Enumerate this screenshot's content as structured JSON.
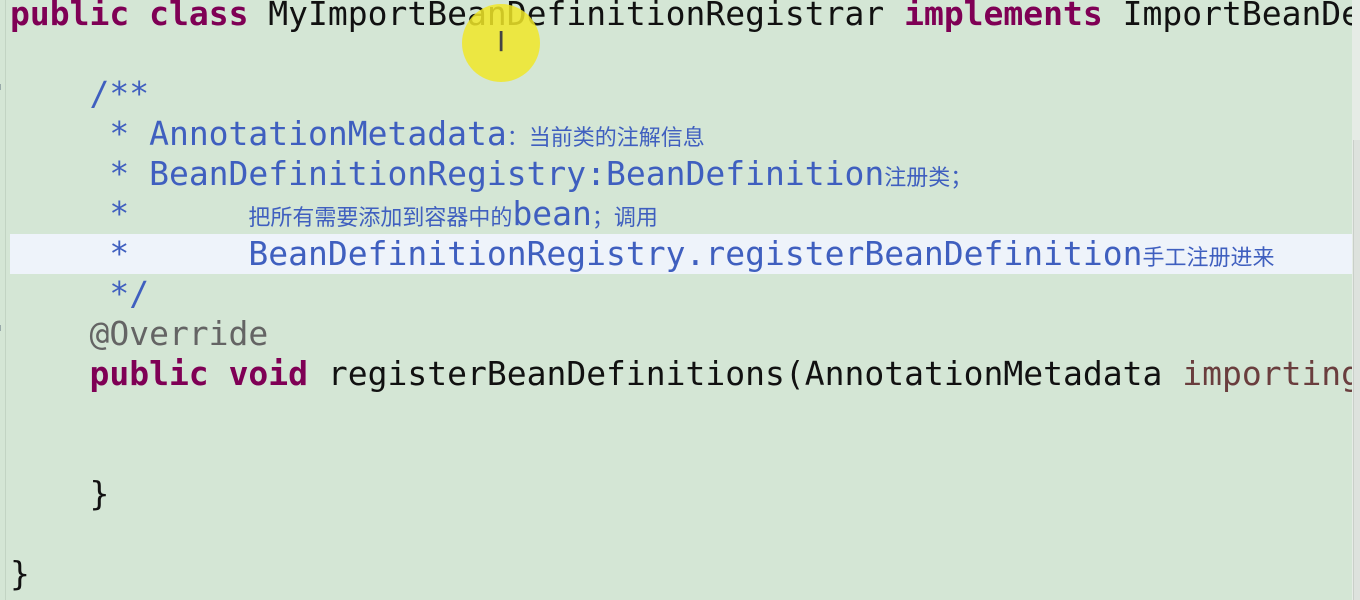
{
  "colors": {
    "background": "#d4e6d5",
    "keyword": "#7f0055",
    "javadoc": "#3f5fbf",
    "annotation": "#646464",
    "parameter": "#6a3e3e",
    "current_line": "#eef3fa",
    "cursor_highlight": "#f0e628"
  },
  "cursor": {
    "icon": "text-ibeam-icon",
    "glyph": "I"
  },
  "editor": {
    "current_line_index": 6,
    "lines": [
      {
        "tokens": [
          {
            "t": "kw",
            "v": "public"
          },
          {
            "t": "pl",
            "v": " "
          },
          {
            "t": "kw",
            "v": "class"
          },
          {
            "t": "pl",
            "v": " MyImportBeanDefinitionRegistrar "
          },
          {
            "t": "kw",
            "v": "implements"
          },
          {
            "t": "pl",
            "v": " ImportBeanDe"
          }
        ]
      },
      {
        "tokens": []
      },
      {
        "tokens": [
          {
            "t": "doc",
            "v": "/**"
          }
        ]
      },
      {
        "tokens": [
          {
            "t": "doc",
            "v": "* AnnotationMetadata"
          },
          {
            "t": "cjk",
            "v": "：当前类的注解信息"
          }
        ]
      },
      {
        "tokens": [
          {
            "t": "doc",
            "v": "* BeanDefinitionRegistry:BeanDefinition"
          },
          {
            "t": "cjk",
            "v": "注册类；"
          }
        ]
      },
      {
        "tokens": [
          {
            "t": "doc",
            "v": "*    "
          },
          {
            "t": "cjk",
            "v": "把所有需要添加到容器中的"
          },
          {
            "t": "doc",
            "v": "bean"
          },
          {
            "t": "cjk",
            "v": "；调用"
          }
        ]
      },
      {
        "tokens": [
          {
            "t": "doc",
            "v": "*    "
          },
          {
            "t": "doc",
            "v": "BeanDefinitionRegistry.registerBeanDefinition"
          },
          {
            "t": "cjk",
            "v": "手工注册进来"
          }
        ]
      },
      {
        "tokens": [
          {
            "t": "doc",
            "v": "*/"
          }
        ]
      },
      {
        "tokens": [
          {
            "t": "ann",
            "v": "@Override"
          }
        ]
      },
      {
        "tokens": [
          {
            "t": "kw",
            "v": "public"
          },
          {
            "t": "pl",
            "v": " "
          },
          {
            "t": "kw",
            "v": "void"
          },
          {
            "t": "pl",
            "v": " registerBeanDefinitions(AnnotationMetadata "
          },
          {
            "t": "param",
            "v": "importing"
          }
        ]
      },
      {
        "tokens": []
      },
      {
        "tokens": []
      },
      {
        "tokens": [
          {
            "t": "pl",
            "v": "}"
          }
        ]
      },
      {
        "tokens": []
      },
      {
        "tokens": [
          {
            "t": "pl",
            "v": "}"
          }
        ]
      }
    ]
  }
}
